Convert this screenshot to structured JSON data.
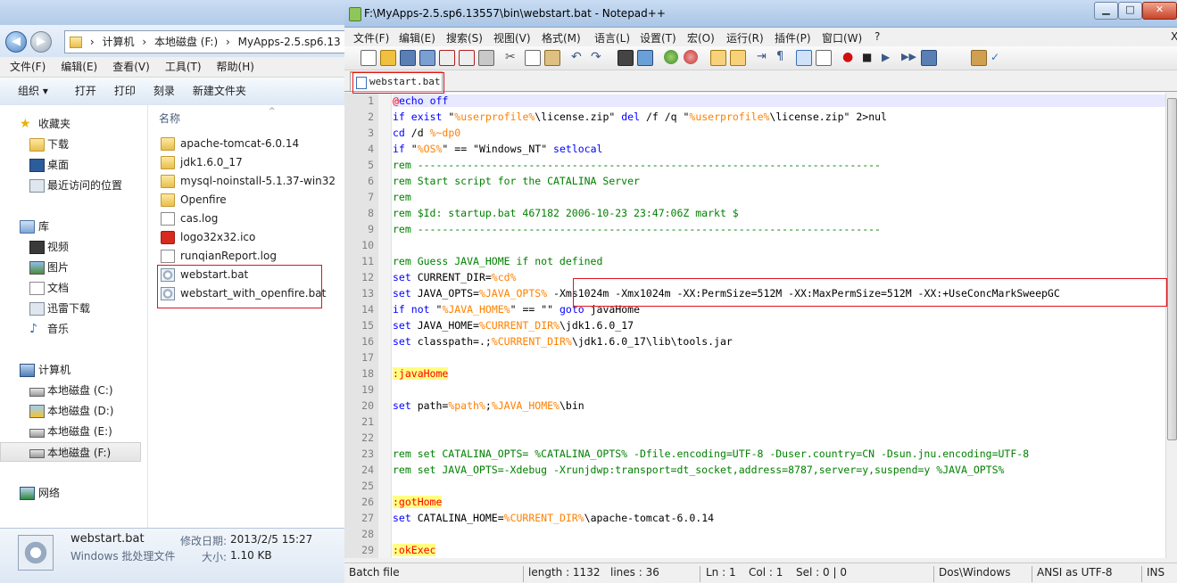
{
  "explorer": {
    "address_parts": [
      "计算机",
      "本地磁盘 (F:)",
      "MyApps-2.5.sp6.13"
    ],
    "menu": [
      "文件(F)",
      "编辑(E)",
      "查看(V)",
      "工具(T)",
      "帮助(H)"
    ],
    "commands": [
      "组织 ▾",
      "打开",
      "打印",
      "刻录",
      "新建文件夹"
    ],
    "nav": {
      "favorites": "收藏夹",
      "favorite_items": [
        "下载",
        "桌面",
        "最近访问的位置"
      ],
      "libraries": "库",
      "library_items": [
        "视频",
        "图片",
        "文档",
        "迅雷下载",
        "音乐"
      ],
      "computer": "计算机",
      "drives": [
        "本地磁盘 (C:)",
        "本地磁盘 (D:)",
        "本地磁盘 (E:)",
        "本地磁盘 (F:)"
      ],
      "network": "网络"
    },
    "column_header": "名称",
    "files": [
      {
        "name": "apache-tomcat-6.0.14",
        "type": "folder"
      },
      {
        "name": "jdk1.6.0_17",
        "type": "folder"
      },
      {
        "name": "mysql-noinstall-5.1.37-win32",
        "type": "folder"
      },
      {
        "name": "Openfire",
        "type": "folder"
      },
      {
        "name": "cas.log",
        "type": "file"
      },
      {
        "name": "logo32x32.ico",
        "type": "ico"
      },
      {
        "name": "runqianReport.log",
        "type": "file"
      },
      {
        "name": "webstart.bat",
        "type": "bat"
      },
      {
        "name": "webstart_with_openfire.bat",
        "type": "bat"
      }
    ],
    "details": {
      "name": "webstart.bat",
      "type": "Windows 批处理文件",
      "modified_label": "修改日期:",
      "modified_value": "2013/2/5 15:27",
      "size_label": "大小:",
      "size_value": "1.10 KB"
    }
  },
  "notepad": {
    "title": "F:\\MyApps-2.5.sp6.13557\\bin\\webstart.bat - Notepad++",
    "window_buttons": {
      "minimize": "▁",
      "maximize": "□",
      "close": "✕"
    },
    "menu": [
      "文件(F)",
      "编辑(E)",
      "搜索(S)",
      "视图(V)",
      "格式(M)",
      "语言(L)",
      "设置(T)",
      "宏(O)",
      "运行(R)",
      "插件(P)",
      "窗口(W)",
      "?"
    ],
    "menu_close": "X",
    "tab": "webstart.bat",
    "status": {
      "lang": "Batch file",
      "length": "length : 1132",
      "lines": "lines : 36",
      "ln": "Ln : 1",
      "col": "Col : 1",
      "sel": "Sel : 0 | 0",
      "eol": "Dos\\Windows",
      "encoding": "ANSI as UTF-8",
      "mode": "INS"
    },
    "lines": [
      {
        "n": "1",
        "t": "@echo off"
      },
      {
        "n": "2",
        "t": "if exist \"%userprofile%\\license.zip\" del /f /q \"%userprofile%\\license.zip\" 2>nul"
      },
      {
        "n": "3",
        "t": "cd /d %~dp0"
      },
      {
        "n": "4",
        "t": "if \"%OS%\" == \"Windows_NT\" setlocal"
      },
      {
        "n": "5",
        "t": "rem ---------------------------------------------------------------------------"
      },
      {
        "n": "6",
        "t": "rem Start script for the CATALINA Server"
      },
      {
        "n": "7",
        "t": "rem"
      },
      {
        "n": "8",
        "t": "rem $Id: startup.bat 467182 2006-10-23 23:47:06Z markt $"
      },
      {
        "n": "9",
        "t": "rem ---------------------------------------------------------------------------"
      },
      {
        "n": "10",
        "t": ""
      },
      {
        "n": "11",
        "t": "rem Guess JAVA_HOME if not defined"
      },
      {
        "n": "12",
        "t": "set CURRENT_DIR=%cd%"
      },
      {
        "n": "13",
        "t": "set JAVA_OPTS=%JAVA_OPTS% -Xms1024m -Xmx1024m -XX:PermSize=512M -XX:MaxPermSize=512M -XX:+UseConcMarkSweepGC"
      },
      {
        "n": "14",
        "t": "if not \"%JAVA_HOME%\" == \"\" goto javaHome"
      },
      {
        "n": "15",
        "t": "set JAVA_HOME=%CURRENT_DIR%\\jdk1.6.0_17"
      },
      {
        "n": "16",
        "t": "set classpath=.;%CURRENT_DIR%\\jdk1.6.0_17\\lib\\tools.jar"
      },
      {
        "n": "17",
        "t": ""
      },
      {
        "n": "18",
        "t": ":javaHome"
      },
      {
        "n": "19",
        "t": ""
      },
      {
        "n": "20",
        "t": "set path=%path%;%JAVA_HOME%\\bin"
      },
      {
        "n": "21",
        "t": ""
      },
      {
        "n": "22",
        "t": ""
      },
      {
        "n": "23",
        "t": "rem set CATALINA_OPTS= %CATALINA_OPTS% -Dfile.encoding=UTF-8 -Duser.country=CN -Dsun.jnu.encoding=UTF-8"
      },
      {
        "n": "24",
        "t": "rem set JAVA_OPTS=-Xdebug -Xrunjdwp:transport=dt_socket,address=8787,server=y,suspend=y %JAVA_OPTS%"
      },
      {
        "n": "25",
        "t": ""
      },
      {
        "n": "26",
        "t": ":gotHome"
      },
      {
        "n": "27",
        "t": "set CATALINA_HOME=%CURRENT_DIR%\\apache-tomcat-6.0.14"
      },
      {
        "n": "28",
        "t": ""
      },
      {
        "n": "29",
        "t": ":okExec"
      }
    ]
  },
  "colors": {
    "keyword": "#0000ff",
    "variable": "#ff8000",
    "comment": "#008000",
    "label_bg": "#ffff80",
    "highlight_box": "#e0141e"
  }
}
